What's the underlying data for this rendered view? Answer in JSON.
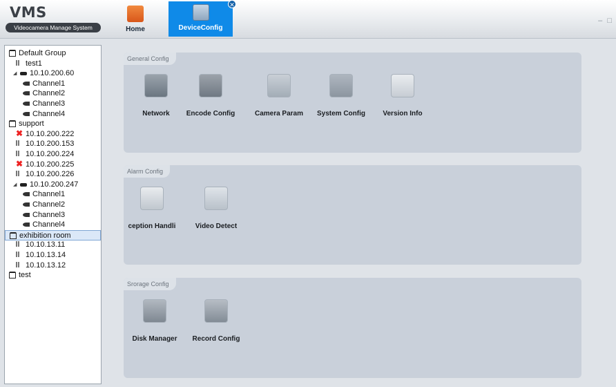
{
  "app": {
    "logo_title": "VMS",
    "logo_subtitle": "Videocamera Manage System"
  },
  "nav": {
    "tabs": [
      {
        "label": "Home",
        "icon": "home-icon",
        "accent": "#e0652a"
      },
      {
        "label": "DeviceConfig",
        "icon": "device-config-icon",
        "accent": "#0f8ae8",
        "closable": true
      }
    ],
    "window_controls": {
      "minimize": "–",
      "maximize": "□"
    }
  },
  "sidebar": {
    "tree": [
      {
        "label": "Default Group",
        "type": "group"
      },
      {
        "label": "test1",
        "type": "plug"
      },
      {
        "label": "10.10.200.60",
        "type": "device",
        "expanded": true
      },
      {
        "label": "Channel1",
        "type": "camera"
      },
      {
        "label": "Channel2",
        "type": "camera"
      },
      {
        "label": "Channel3",
        "type": "camera"
      },
      {
        "label": "Channel4",
        "type": "camera"
      },
      {
        "label": "support",
        "type": "group"
      },
      {
        "label": "10.10.200.222",
        "type": "error"
      },
      {
        "label": "10.10.200.153",
        "type": "plug"
      },
      {
        "label": "10.10.200.224",
        "type": "plug"
      },
      {
        "label": "10.10.200.225",
        "type": "error"
      },
      {
        "label": "10.10.200.226",
        "type": "plug"
      },
      {
        "label": "10.10.200.247",
        "type": "device",
        "expanded": true
      },
      {
        "label": "Channel1",
        "type": "camera"
      },
      {
        "label": "Channel2",
        "type": "camera"
      },
      {
        "label": "Channel3",
        "type": "camera"
      },
      {
        "label": "Channel4",
        "type": "camera"
      },
      {
        "label": "exhibition room",
        "type": "group",
        "selected": true
      },
      {
        "label": "10.10.13.11",
        "type": "plug"
      },
      {
        "label": "10.10.13.14",
        "type": "plug"
      },
      {
        "label": "10.10.13.12",
        "type": "plug"
      },
      {
        "label": "test",
        "type": "group"
      }
    ]
  },
  "panels": {
    "general": {
      "title": "General Config",
      "items": [
        {
          "label": "Network",
          "icon": "network-icon"
        },
        {
          "label": "Encode Config",
          "icon": "encode-config-icon"
        },
        {
          "label": "Camera Param",
          "icon": "camera-param-icon"
        },
        {
          "label": "System Config",
          "icon": "system-config-icon"
        },
        {
          "label": "Version Info",
          "icon": "version-info-icon"
        }
      ]
    },
    "alarm": {
      "title": "Alarm Config",
      "items": [
        {
          "label": "ception Handli",
          "icon": "exception-handling-icon"
        },
        {
          "label": "Video Detect",
          "icon": "video-detect-icon"
        }
      ]
    },
    "storage": {
      "title": "Srorage Config",
      "items": [
        {
          "label": "Disk Manager",
          "icon": "disk-manager-icon"
        },
        {
          "label": "Record Config",
          "icon": "record-config-icon"
        }
      ]
    }
  }
}
